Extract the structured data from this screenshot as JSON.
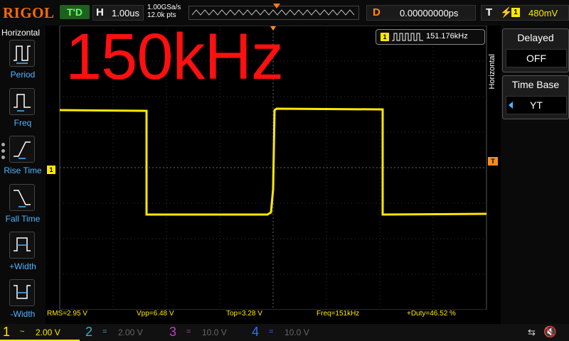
{
  "brand": "RIGOL",
  "run_state": "T'D",
  "horizontal_scale": {
    "key": "H",
    "value": "1.00us"
  },
  "sample_rate": {
    "rate": "1.00GSa/s",
    "points": "12.0k pts"
  },
  "delay": {
    "key": "D",
    "value": "0.00000000ps"
  },
  "trigger": {
    "key": "T",
    "channel": "1",
    "level": "480mV"
  },
  "left_menu": {
    "title": "Horizontal",
    "items": [
      {
        "label": "Period"
      },
      {
        "label": "Freq"
      },
      {
        "label": "Rise Time"
      },
      {
        "label": "Fall Time"
      },
      {
        "label": "+Width"
      },
      {
        "label": "-Width"
      }
    ]
  },
  "right_menu": {
    "vertical_label": "Horizontal",
    "delayed": {
      "label": "Delayed",
      "value": "OFF"
    },
    "time_base": {
      "label": "Time Base",
      "value": "YT"
    }
  },
  "overlay_text": "150kHz",
  "freq_counter": {
    "channel": "1",
    "value": "151.176kHz"
  },
  "ch1_marker": "1",
  "trigger_marker": "T",
  "measurements": {
    "rms": "RMS=2.95 V",
    "vpp": "Vpp=6.48 V",
    "top": "Top=3.28 V",
    "freq": "Freq=151kHz",
    "duty": "+Duty=46.52 %"
  },
  "channels": [
    {
      "num": "1",
      "coupling": "~",
      "scale": "2.00 V",
      "color": "#ffe800"
    },
    {
      "num": "2",
      "coupling": "=",
      "scale": "2.00 V",
      "color": "#3ab0c0"
    },
    {
      "num": "3",
      "coupling": "=",
      "scale": "10.0 V",
      "color": "#c040c0"
    },
    {
      "num": "4",
      "coupling": "=",
      "scale": "10.0 V",
      "color": "#3070ff"
    }
  ],
  "colors": {
    "ch1": "#ffe800",
    "accent_orange": "#ff8c1a",
    "menu_blue": "#4fb4ff",
    "overlay_red": "#ff1010"
  }
}
